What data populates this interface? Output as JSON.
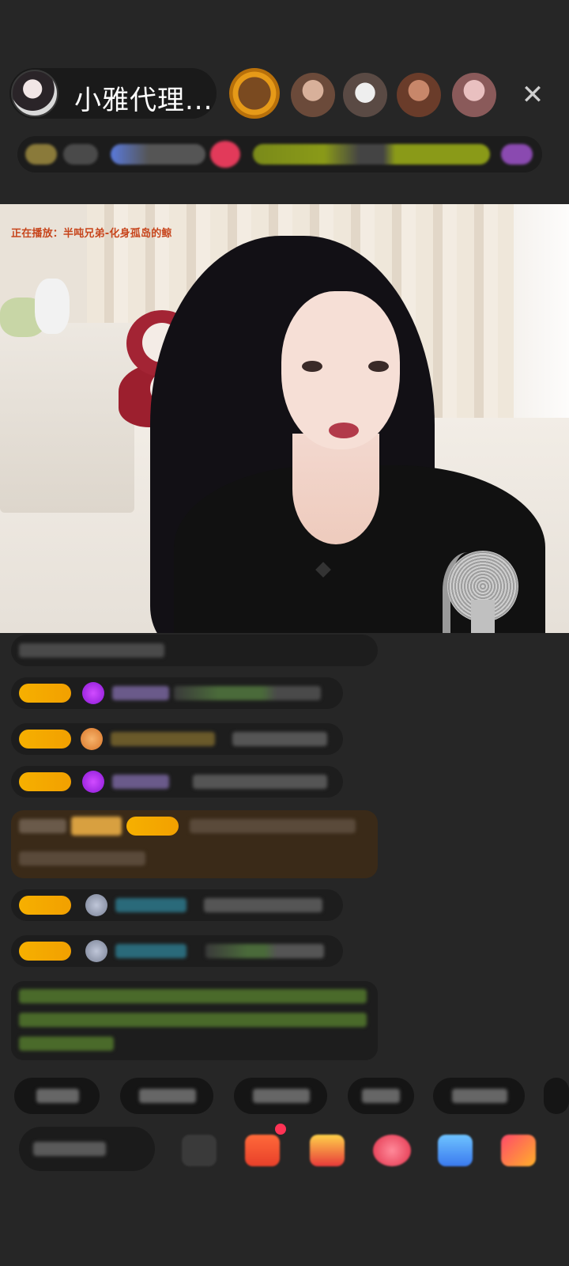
{
  "header": {
    "host_name": "小雅代理...",
    "close_icon": "close-icon"
  },
  "video": {
    "now_playing": "正在播放：半吨兄弟-化身孤岛的鲸"
  },
  "colors": {
    "background": "#262626",
    "badge_gold": "#f6b000",
    "now_playing": "#c7451c",
    "chat_bubble": "#1d1d1d",
    "highlight_bubble": "#3a2a18"
  }
}
